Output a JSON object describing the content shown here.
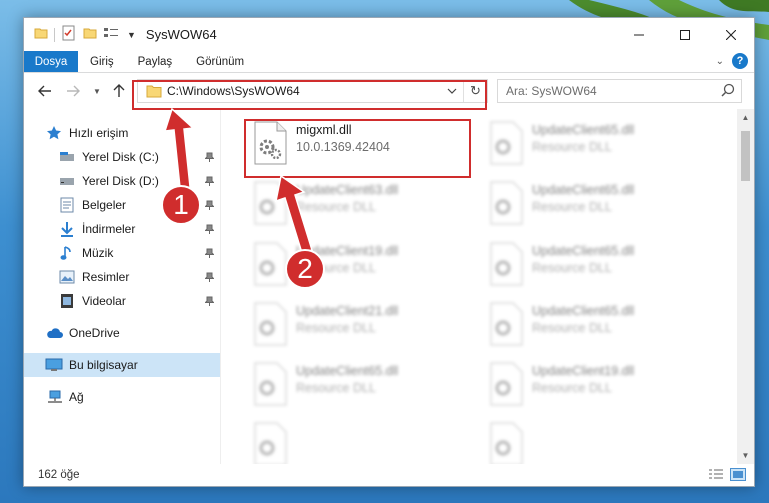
{
  "window": {
    "title": "SysWOW64"
  },
  "ribbon": {
    "tabs": [
      {
        "label": "Dosya",
        "active": true
      },
      {
        "label": "Giriş"
      },
      {
        "label": "Paylaş"
      },
      {
        "label": "Görünüm"
      }
    ],
    "help": "?"
  },
  "address": {
    "path": "C:\\Windows\\SysWOW64"
  },
  "search": {
    "placeholder": "Ara: SysWOW64"
  },
  "sidebar": {
    "items": [
      {
        "label": "Hızlı erişim",
        "icon": "star-icon",
        "level": 1
      },
      {
        "label": "Yerel Disk (C:)",
        "icon": "drive-icon",
        "level": 2,
        "pinned": true
      },
      {
        "label": "Yerel Disk (D:)",
        "icon": "drive-icon",
        "level": 2,
        "pinned": true
      },
      {
        "label": "Belgeler",
        "icon": "documents-icon",
        "level": 2,
        "pinned": true
      },
      {
        "label": "İndirmeler",
        "icon": "download-icon",
        "level": 2,
        "pinned": true
      },
      {
        "label": "Müzik",
        "icon": "music-icon",
        "level": 2,
        "pinned": true
      },
      {
        "label": "Resimler",
        "icon": "pictures-icon",
        "level": 2,
        "pinned": true
      },
      {
        "label": "Videolar",
        "icon": "video-icon",
        "level": 2,
        "pinned": true
      },
      {
        "label": "OneDrive",
        "icon": "cloud-icon",
        "level": 1
      },
      {
        "label": "Bu bilgisayar",
        "icon": "computer-icon",
        "level": 1,
        "selected": true
      },
      {
        "label": "Ağ",
        "icon": "network-icon",
        "level": 1
      }
    ]
  },
  "files": [
    {
      "name": "migxml.dll",
      "desc": "10.0.1369.42404",
      "highlighted": true
    },
    {
      "name": "UpdateClient65.dll",
      "desc": "Resource DLL"
    },
    {
      "name": "UpdateClient63.dll",
      "desc": "Resource DLL"
    },
    {
      "name": "UpdateClient65.dll",
      "desc": "Resource DLL"
    },
    {
      "name": "UpdateClient19.dll",
      "desc": "Resource DLL"
    },
    {
      "name": "UpdateClient65.dll",
      "desc": "Resource DLL"
    },
    {
      "name": "UpdateClient21.dll",
      "desc": "Resource DLL"
    },
    {
      "name": "UpdateClient65.dll",
      "desc": "Resource DLL"
    },
    {
      "name": "UpdateClient65.dll",
      "desc": "Resource DLL"
    },
    {
      "name": "UpdateClient19.dll",
      "desc": "Resource DLL"
    },
    {
      "name": "",
      "desc": ""
    },
    {
      "name": "",
      "desc": ""
    }
  ],
  "status": {
    "count": "162 öğe"
  },
  "annotations": {
    "step1": "1",
    "step2": "2"
  },
  "colors": {
    "accent": "#1979ca",
    "annotation": "#d02d2d",
    "selected": "#cce4f7"
  }
}
